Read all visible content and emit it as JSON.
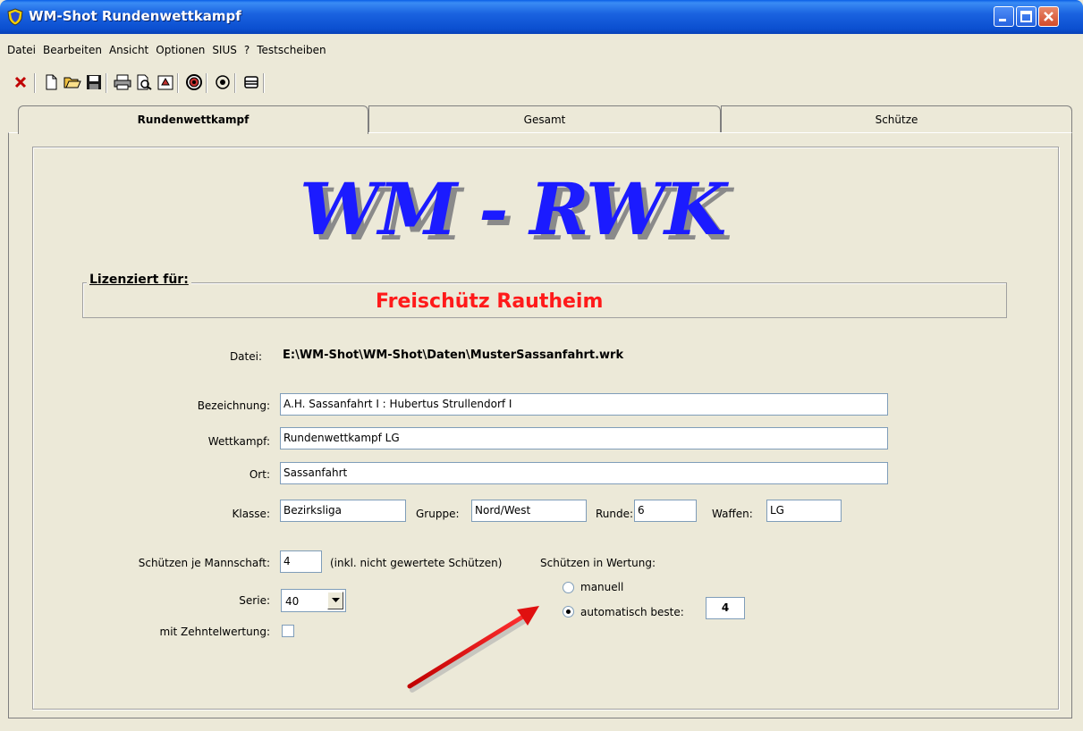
{
  "window": {
    "title": "WM-Shot Rundenwettkampf"
  },
  "menu": [
    "Datei",
    "Bearbeiten",
    "Ansicht",
    "Optionen",
    "SIUS",
    "?",
    "Testscheiben"
  ],
  "toolbar_icons": [
    "delete-icon",
    "new-file-icon",
    "open-folder-icon",
    "save-disk-icon",
    "print-icon",
    "print-preview-icon",
    "export-icon",
    "target-icon",
    "record-icon",
    "list-icon"
  ],
  "tabs": [
    {
      "label": "Rundenwettkampf",
      "active": true
    },
    {
      "label": "Gesamt",
      "active": false
    },
    {
      "label": "Schütze",
      "active": false
    }
  ],
  "logo": "WM - RWK",
  "license": {
    "legend": "Lizenziert für:",
    "name": "Freischütz Rautheim"
  },
  "datei": {
    "label": "Datei:",
    "value": "E:\\WM-Shot\\WM-Shot\\Daten\\MusterSassanfahrt.wrk"
  },
  "form": {
    "bezeichnung_label": "Bezeichnung:",
    "bezeichnung": "A.H. Sassanfahrt  I  :  Hubertus Strullendorf  I",
    "wettkampf_label": "Wettkampf:",
    "wettkampf": "Rundenwettkampf  LG",
    "ort_label": "Ort:",
    "ort": "Sassanfahrt",
    "klasse_label": "Klasse:",
    "klasse": "Bezirksliga",
    "gruppe_label": "Gruppe:",
    "gruppe": "Nord/West",
    "runde_label": "Runde:",
    "runde": "6",
    "waffen_label": "Waffen:",
    "waffen": "LG",
    "schuetzen_label": "Schützen je Mannschaft:",
    "schuetzen": "4",
    "schuetzen_note": "(inkl. nicht gewertete Schützen)",
    "serie_label": "Serie:",
    "serie": "40",
    "zehntel_label": "mit Zehntelwertung:",
    "zehntel_checked": false,
    "wertung_label": "Schützen in Wertung:",
    "wertung_manual": "manuell",
    "wertung_auto": "automatisch beste:",
    "wertung_selected": "auto",
    "auto_value": "4"
  },
  "colors": {
    "logo": "#1b1bff",
    "license_name": "#ff1a1a",
    "arrow": "#e01010"
  }
}
